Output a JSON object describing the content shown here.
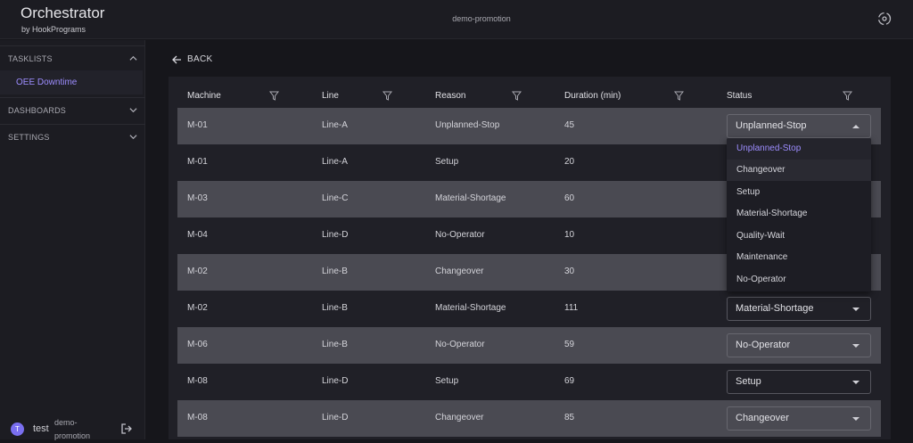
{
  "app": {
    "title": "Orchestrator",
    "subtitle": "by HookPrograms",
    "workspace": "demo-promotion"
  },
  "sidebar": {
    "tasklists_label": "TASKLISTS",
    "active_item": "OEE Downtime",
    "dashboards_label": "DASHBOARDS",
    "settings_label": "SETTINGS"
  },
  "user": {
    "initial": "T",
    "name": "test",
    "workspace": "demo-promotion"
  },
  "back_label": "BACK",
  "table": {
    "columns": [
      "Machine",
      "Line",
      "Reason",
      "Duration (min)",
      "Status"
    ],
    "rows": [
      {
        "machine": "M-01",
        "line": "Line-A",
        "reason": "Unplanned-Stop",
        "duration": "45",
        "status": "Unplanned-Stop"
      },
      {
        "machine": "M-01",
        "line": "Line-A",
        "reason": "Setup",
        "duration": "20",
        "status": ""
      },
      {
        "machine": "M-03",
        "line": "Line-C",
        "reason": "Material-Shortage",
        "duration": "60",
        "status": ""
      },
      {
        "machine": "M-04",
        "line": "Line-D",
        "reason": "No-Operator",
        "duration": "10",
        "status": ""
      },
      {
        "machine": "M-02",
        "line": "Line-B",
        "reason": "Changeover",
        "duration": "30",
        "status": ""
      },
      {
        "machine": "M-02",
        "line": "Line-B",
        "reason": "Material-Shortage",
        "duration": "111",
        "status": "Material-Shortage"
      },
      {
        "machine": "M-06",
        "line": "Line-B",
        "reason": "No-Operator",
        "duration": "59",
        "status": "No-Operator"
      },
      {
        "machine": "M-08",
        "line": "Line-D",
        "reason": "Setup",
        "duration": "69",
        "status": "Setup"
      },
      {
        "machine": "M-08",
        "line": "Line-D",
        "reason": "Changeover",
        "duration": "85",
        "status": "Changeover"
      }
    ]
  },
  "status_options": [
    "Unplanned-Stop",
    "Changeover",
    "Setup",
    "Material-Shortage",
    "Quality-Wait",
    "Maintenance",
    "No-Operator"
  ],
  "colors": {
    "accent": "#9d8dff",
    "row_shade": "#4a4a52",
    "background": "#16161b"
  }
}
